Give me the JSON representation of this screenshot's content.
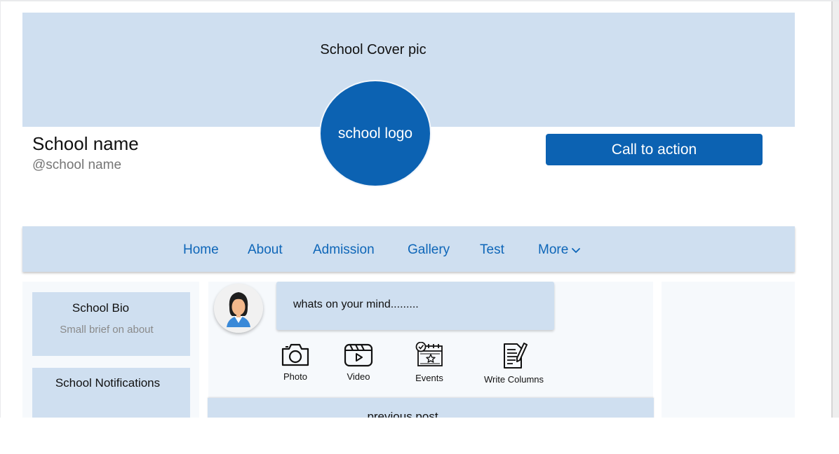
{
  "header": {
    "cover_label": "School Cover pic",
    "logo_label": "school logo",
    "school_name": "School name",
    "school_handle": "@school name",
    "cta_label": "Call to action"
  },
  "nav": {
    "items": [
      {
        "label": "Home"
      },
      {
        "label": "About"
      },
      {
        "label": "Admission"
      },
      {
        "label": "Gallery"
      },
      {
        "label": "Test"
      },
      {
        "label": "More"
      }
    ]
  },
  "sidebar": {
    "bio_title": "School Bio",
    "bio_subtitle": "Small brief on about",
    "notifications_title": "School Notifications"
  },
  "composer": {
    "placeholder": "whats on your  mind.........",
    "actions": [
      {
        "label": "Photo",
        "icon": "camera-icon"
      },
      {
        "label": "Video",
        "icon": "video-icon"
      },
      {
        "label": "Events",
        "icon": "calendar-event-icon"
      },
      {
        "label": "Write Columns",
        "icon": "write-document-icon"
      }
    ]
  },
  "feed": {
    "previous_post_label": "previous post"
  },
  "colors": {
    "accent": "#0c62b2",
    "panel": "#cfdff0",
    "nav_text": "#0e66b8"
  }
}
